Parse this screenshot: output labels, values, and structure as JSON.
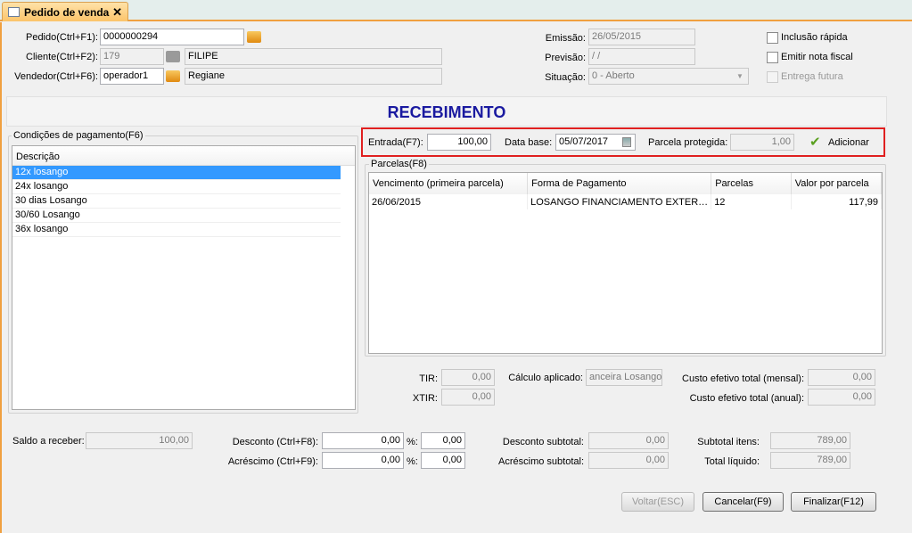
{
  "tab": {
    "title": "Pedido de venda",
    "close": "✕"
  },
  "header": {
    "pedido_label": "Pedido(Ctrl+F1):",
    "pedido_value": "0000000294",
    "cliente_label": "Cliente(Ctrl+F2):",
    "cliente_code": "179",
    "cliente_name": "FILIPE",
    "vendedor_label": "Vendedor(Ctrl+F6):",
    "vendedor_code": "operador1",
    "vendedor_name": "Regiane",
    "emissao_label": "Emissão:",
    "emissao_value": "26/05/2015",
    "previsao_label": "Previsão:",
    "previsao_value": " /  /",
    "situacao_label": "Situação:",
    "situacao_value": "0 - Aberto",
    "inclusao_rapida": "Inclusão rápida",
    "emitir_nota": "Emitir nota fiscal",
    "entrega_futura": "Entrega futura"
  },
  "section_title": "RECEBIMENTO",
  "condicoes": {
    "title": "Condições de pagamento(F6)",
    "column": "Descrição",
    "items": [
      "12x losango",
      "24x losango",
      "30 dias Losango",
      "30/60 Losango",
      "36x losango"
    ]
  },
  "entrada": {
    "label": "Entrada(F7):",
    "value": "100,00",
    "data_base_label": "Data base:",
    "data_base_value": "05/07/2017",
    "parcela_label": "Parcela protegida:",
    "parcela_value": "1,00",
    "adicionar": "Adicionar"
  },
  "parcelas": {
    "title": "Parcelas(F8)",
    "columns": [
      "Vencimento (primeira parcela)",
      "Forma de Pagamento",
      "Parcelas",
      "Valor por parcela"
    ],
    "rows": [
      [
        "26/06/2015",
        "LOSANGO FINANCIAMENTO EXTER…",
        "12",
        "117,99"
      ]
    ]
  },
  "taxas": {
    "tir_label": "TIR:",
    "tir": "0,00",
    "xtir_label": "XTIR:",
    "xtir": "0,00",
    "calculo_label": "Cálculo aplicado:",
    "calculo": "anceira Losango",
    "cet_mensal_label": "Custo efetivo total (mensal):",
    "cet_mensal": "0,00",
    "cet_anual_label": "Custo efetivo total (anual):",
    "cet_anual": "0,00"
  },
  "totais": {
    "saldo_label": "Saldo a receber:",
    "saldo": "100,00",
    "desconto_label": "Desconto (Ctrl+F8):",
    "desconto": "0,00",
    "pct": "%:",
    "desconto_pct": "0,00",
    "acrescimo_label": "Acréscimo (Ctrl+F9):",
    "acrescimo": "0,00",
    "acrescimo_pct": "0,00",
    "desc_sub_label": "Desconto subtotal:",
    "desc_sub": "0,00",
    "acr_sub_label": "Acréscimo subtotal:",
    "acr_sub": "0,00",
    "subtotal_label": "Subtotal itens:",
    "subtotal": "789,00",
    "liquido_label": "Total líquido:",
    "liquido": "789,00"
  },
  "buttons": {
    "voltar": "Voltar(ESC)",
    "cancelar": "Cancelar(F9)",
    "finalizar": "Finalizar(F12)"
  }
}
